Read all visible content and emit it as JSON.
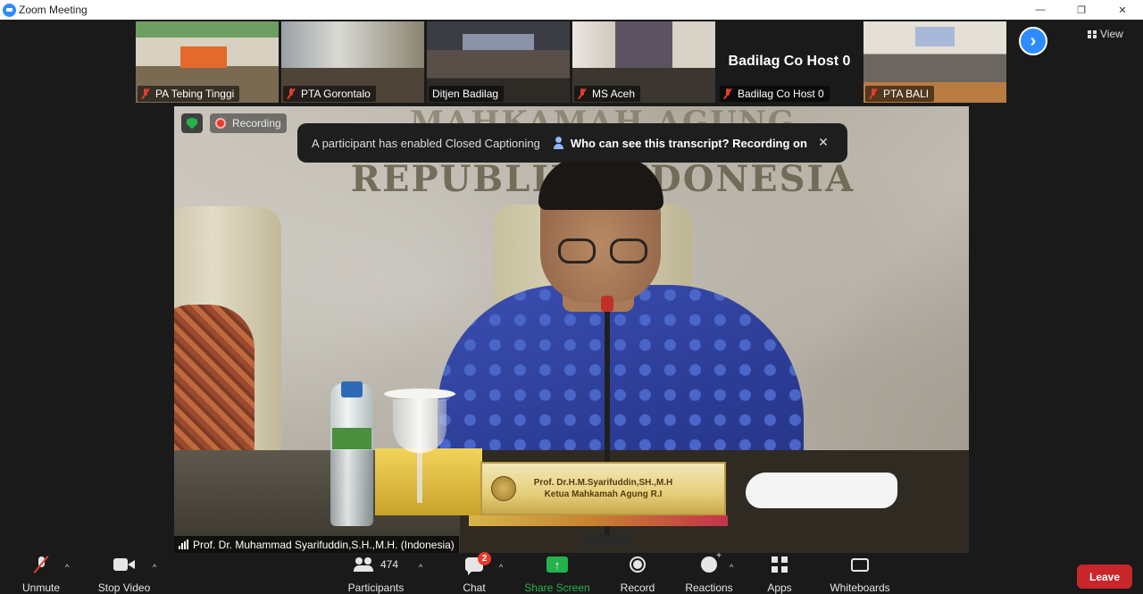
{
  "window": {
    "title": "Zoom Meeting",
    "controls": {
      "minimize": "—",
      "maximize": "❐",
      "close": "✕"
    }
  },
  "thumbnails": [
    {
      "name": "PA  Tebing Tinggi",
      "muted": true,
      "scene": "room-a"
    },
    {
      "name": "PTA Gorontalo",
      "muted": true,
      "scene": "room-b"
    },
    {
      "name": "Ditjen Badilag",
      "muted": false,
      "scene": "room-c"
    },
    {
      "name": "MS  Aceh",
      "muted": true,
      "scene": "room-d"
    },
    {
      "name": "Badilag Co Host 0",
      "muted": true,
      "scene": "no-video",
      "display_name": "Badilag Co Host 0"
    },
    {
      "name": "PTA  BALI",
      "muted": true,
      "scene": "room-e"
    }
  ],
  "view_button": {
    "label": "View",
    "icon": "grid-view-icon"
  },
  "next_page_icon": "chevron-right-icon",
  "main_video": {
    "wall_line1": "MAHKAMAH AGUNG",
    "wall_line2": "REPUBLIK INDONESIA",
    "nameplate_line1": "Prof. Dr.H.M.Syarifuddin,SH.,M.H",
    "nameplate_line2": "Ketua Mahkamah Agung R.I",
    "speaker_name": "Prof. Dr. Muhammad Syarifuddin,S.H.,M.H. (Indonesia)"
  },
  "recording_label": "Recording",
  "toast": {
    "message": "A participant has enabled Closed Captioning",
    "link": "Who can see this transcript? Recording on",
    "close": "✕"
  },
  "toolbar": {
    "unmute": "Unmute",
    "stop_video": "Stop Video",
    "participants": "Participants",
    "participants_count": "474",
    "chat": "Chat",
    "chat_badge": "2",
    "share_screen": "Share Screen",
    "record": "Record",
    "reactions": "Reactions",
    "apps": "Apps",
    "whiteboards": "Whiteboards",
    "leave": "Leave",
    "caret": "^"
  },
  "colors": {
    "accent_blue": "#2d8cff",
    "share_green": "#23b34a",
    "leave_red": "#c8262b",
    "badge_red": "#e8392c"
  }
}
